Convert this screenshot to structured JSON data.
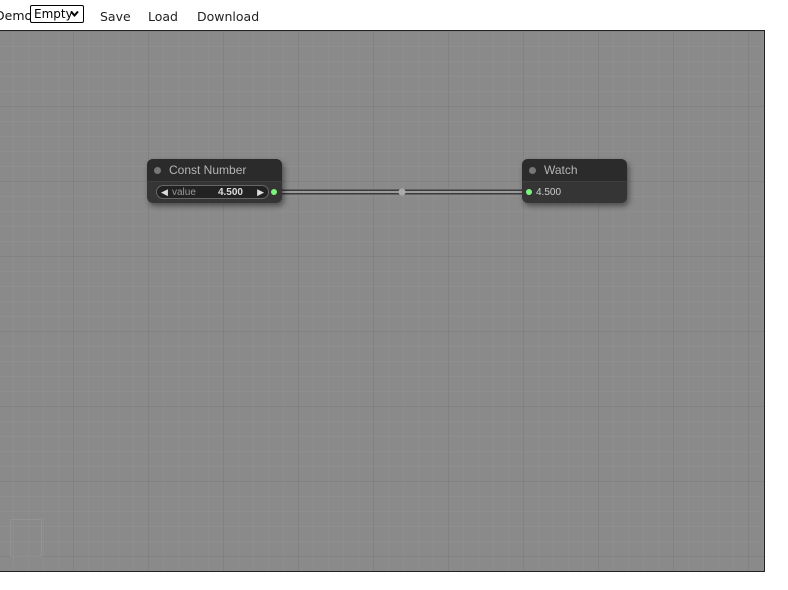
{
  "toolbar": {
    "demo_label": "Demo",
    "demo_select_value": "Empty",
    "save_label": "Save",
    "load_label": "Load",
    "download_label": "Download"
  },
  "graph": {
    "nodes": [
      {
        "title": "Const Number",
        "widget": {
          "label": "value",
          "value": "4.500"
        }
      },
      {
        "title": "Watch",
        "output_text": "4.500"
      }
    ],
    "link_color": "#9a9a9a",
    "slot_color": "#7cf57c"
  }
}
